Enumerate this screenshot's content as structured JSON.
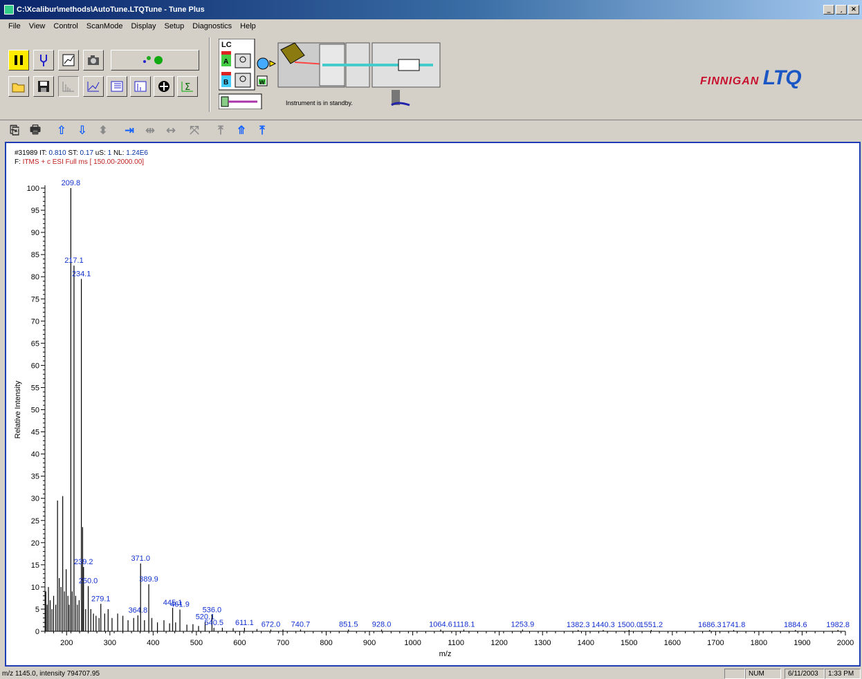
{
  "window": {
    "title": "C:\\Xcalibur\\methods\\AutoTune.LTQTune - Tune Plus",
    "buttons": [
      "_",
      "¸",
      "×"
    ]
  },
  "menu": [
    {
      "label": "File"
    },
    {
      "label": "View"
    },
    {
      "label": "Control"
    },
    {
      "label": "ScanMode"
    },
    {
      "label": "Display"
    },
    {
      "label": "Setup"
    },
    {
      "label": "Diagnostics"
    },
    {
      "label": "Help"
    }
  ],
  "instrument": {
    "status": "Instrument is in standby.",
    "lc_label": "LC",
    "pump_a": "A",
    "pump_b": "B",
    "waste": "W"
  },
  "logo": {
    "brand": "FINNIGAN",
    "model": "LTQ"
  },
  "toolbar_icons": {
    "row1": [
      "pause-icon",
      "tune-fork-icon",
      "diagnostics-chart-icon",
      "camera-icon",
      "status-dots-icon"
    ],
    "row2": [
      "open-icon",
      "save-icon",
      "spectrum-view-icon",
      "graph-view-icon",
      "table-view-icon",
      "bar-view-icon",
      "polarity-icon",
      "sum-icon"
    ],
    "spectrum": [
      "copy-icon",
      "print-icon",
      "arrow-up-icon",
      "arrow-down-icon",
      "arrow-updown-icon",
      "zoom-in-x-icon",
      "zoom-out-x-icon",
      "pan-x-icon",
      "reset-zoom-icon",
      "normalize-icon",
      "autoscale-icon",
      "scale-top-icon"
    ]
  },
  "scan": {
    "scan_number": "#31989",
    "it_label": "IT:",
    "it": "0.810",
    "st_label": "ST:",
    "st": "0.17",
    "us_label": "uS:",
    "us": "1",
    "nl_label": "NL:",
    "nl": "1.24E6",
    "filter_label": "F:",
    "filter": "ITMS + c ESI Full ms [ 150.00-2000.00]"
  },
  "chart_data": {
    "type": "bar",
    "xlabel": "m/z",
    "ylabel": "Relative Intensity",
    "xlim": [
      150,
      2000
    ],
    "ylim": [
      0,
      100
    ],
    "x_ticks": [
      200,
      300,
      400,
      500,
      600,
      700,
      800,
      900,
      1000,
      1100,
      1200,
      1300,
      1400,
      1500,
      1600,
      1700,
      1800,
      1900,
      2000
    ],
    "y_ticks": [
      0,
      5,
      10,
      15,
      20,
      25,
      30,
      35,
      40,
      45,
      50,
      55,
      60,
      65,
      70,
      75,
      80,
      85,
      90,
      95,
      100
    ],
    "labeled_peaks": [
      {
        "mz": 209.8,
        "intensity": 100,
        "label": "209.8"
      },
      {
        "mz": 217.1,
        "intensity": 82.5,
        "label": "217.1"
      },
      {
        "mz": 234.1,
        "intensity": 79.5,
        "label": "234.1"
      },
      {
        "mz": 239.2,
        "intensity": 14.5,
        "label": "239.2"
      },
      {
        "mz": 250.0,
        "intensity": 10.2,
        "label": "250.0"
      },
      {
        "mz": 279.1,
        "intensity": 6.2,
        "label": "279.1"
      },
      {
        "mz": 364.8,
        "intensity": 3.6,
        "label": "364.8"
      },
      {
        "mz": 371.0,
        "intensity": 15.3,
        "label": "371.0"
      },
      {
        "mz": 389.9,
        "intensity": 10.6,
        "label": "389.9"
      },
      {
        "mz": 445.1,
        "intensity": 5.3,
        "label": "445.1"
      },
      {
        "mz": 461.9,
        "intensity": 4.9,
        "label": "461.9"
      },
      {
        "mz": 520.1,
        "intensity": 2.1,
        "label": "520.1"
      },
      {
        "mz": 536.0,
        "intensity": 3.7,
        "label": "536.0"
      },
      {
        "mz": 540.5,
        "intensity": 0.8,
        "label": "540.5"
      },
      {
        "mz": 611.1,
        "intensity": 0.8,
        "label": "611.1"
      },
      {
        "mz": 672.0,
        "intensity": 0.4,
        "label": "672.0"
      },
      {
        "mz": 740.7,
        "intensity": 0.4,
        "label": "740.7"
      },
      {
        "mz": 851.5,
        "intensity": 0.4,
        "label": "851.5"
      },
      {
        "mz": 928.0,
        "intensity": 0.4,
        "label": "928.0"
      },
      {
        "mz": 1064.6,
        "intensity": 0.4,
        "label": "1064.6"
      },
      {
        "mz": 1118.1,
        "intensity": 0.4,
        "label": "1118.1"
      },
      {
        "mz": 1253.9,
        "intensity": 0.4,
        "label": "1253.9"
      },
      {
        "mz": 1382.3,
        "intensity": 0.3,
        "label": "1382.3"
      },
      {
        "mz": 1440.3,
        "intensity": 0.3,
        "label": "1440.3"
      },
      {
        "mz": 1500.0,
        "intensity": 0.3,
        "label": "1500.0"
      },
      {
        "mz": 1551.2,
        "intensity": 0.3,
        "label": "1551.2"
      },
      {
        "mz": 1686.3,
        "intensity": 0.3,
        "label": "1686.3"
      },
      {
        "mz": 1741.8,
        "intensity": 0.3,
        "label": "1741.8"
      },
      {
        "mz": 1884.6,
        "intensity": 0.3,
        "label": "1884.6"
      },
      {
        "mz": 1982.8,
        "intensity": 0.3,
        "label": "1982.8"
      }
    ],
    "unlabeled_peaks": [
      {
        "mz": 152,
        "intensity": 9
      },
      {
        "mz": 155,
        "intensity": 6
      },
      {
        "mz": 158,
        "intensity": 10
      },
      {
        "mz": 162,
        "intensity": 7
      },
      {
        "mz": 166,
        "intensity": 5
      },
      {
        "mz": 170,
        "intensity": 8
      },
      {
        "mz": 175,
        "intensity": 6
      },
      {
        "mz": 179,
        "intensity": 29.5
      },
      {
        "mz": 183,
        "intensity": 12
      },
      {
        "mz": 187,
        "intensity": 10
      },
      {
        "mz": 191,
        "intensity": 30.5
      },
      {
        "mz": 195,
        "intensity": 9
      },
      {
        "mz": 199,
        "intensity": 14
      },
      {
        "mz": 203,
        "intensity": 8
      },
      {
        "mz": 206,
        "intensity": 6
      },
      {
        "mz": 213,
        "intensity": 9
      },
      {
        "mz": 221,
        "intensity": 8
      },
      {
        "mz": 225,
        "intensity": 6
      },
      {
        "mz": 229,
        "intensity": 7
      },
      {
        "mz": 237,
        "intensity": 23.5
      },
      {
        "mz": 244,
        "intensity": 5
      },
      {
        "mz": 256,
        "intensity": 5
      },
      {
        "mz": 262,
        "intensity": 4
      },
      {
        "mz": 268,
        "intensity": 3.5
      },
      {
        "mz": 275,
        "intensity": 3
      },
      {
        "mz": 288,
        "intensity": 4
      },
      {
        "mz": 296,
        "intensity": 5
      },
      {
        "mz": 305,
        "intensity": 3
      },
      {
        "mz": 318,
        "intensity": 4
      },
      {
        "mz": 330,
        "intensity": 3.5
      },
      {
        "mz": 342,
        "intensity": 2.5
      },
      {
        "mz": 355,
        "intensity": 3
      },
      {
        "mz": 380,
        "intensity": 2.5
      },
      {
        "mz": 397,
        "intensity": 3
      },
      {
        "mz": 410,
        "intensity": 2
      },
      {
        "mz": 425,
        "intensity": 2.5
      },
      {
        "mz": 438,
        "intensity": 1.8
      },
      {
        "mz": 452,
        "intensity": 2
      },
      {
        "mz": 478,
        "intensity": 1.5
      },
      {
        "mz": 492,
        "intensity": 1.6
      },
      {
        "mz": 505,
        "intensity": 1.2
      },
      {
        "mz": 560,
        "intensity": 0.8
      },
      {
        "mz": 585,
        "intensity": 0.7
      },
      {
        "mz": 640,
        "intensity": 0.5
      },
      {
        "mz": 700,
        "intensity": 0.4
      }
    ],
    "colors": {
      "peak": "#000000",
      "label": "#1030d0",
      "axis": "#000000"
    }
  },
  "statusbar": {
    "cursor": "m/z 1145.0, intensity 794707.95",
    "num": "NUM",
    "date": "6/11/2003",
    "time": "1:33 PM"
  }
}
